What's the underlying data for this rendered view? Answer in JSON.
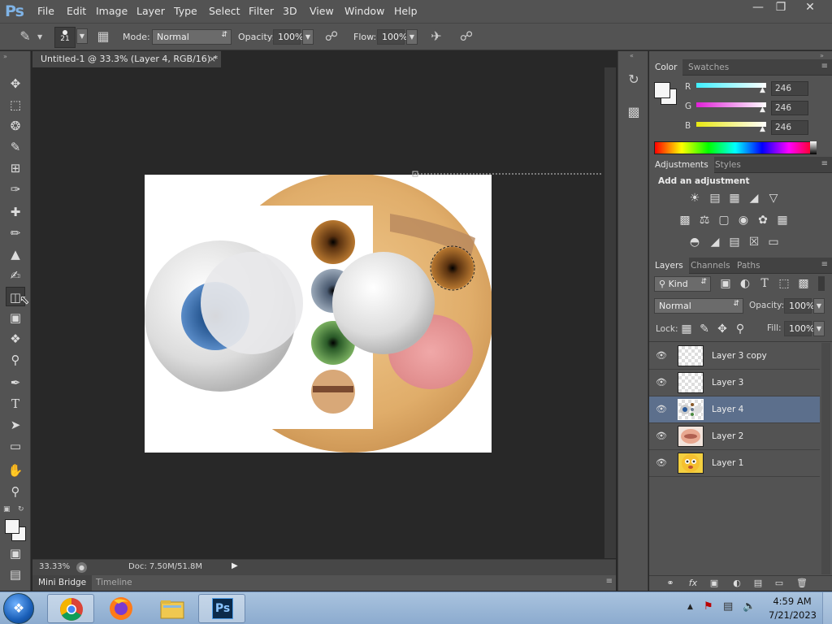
{
  "app": {
    "logo": "Ps"
  },
  "menu": [
    "File",
    "Edit",
    "Image",
    "Layer",
    "Type",
    "Select",
    "Filter",
    "3D",
    "View",
    "Window",
    "Help"
  ],
  "options": {
    "brush_size": "21",
    "mode_label": "Mode:",
    "mode_value": "Normal",
    "opacity_label": "Opacity:",
    "opacity_value": "100%",
    "flow_label": "Flow:",
    "flow_value": "100%"
  },
  "document": {
    "tab_title": "Untitled-1 @ 33.3% (Layer 4, RGB/16) *",
    "zoom": "33.33%",
    "doc_size": "Doc: 7.50M/51.8M"
  },
  "bottom_tabs": [
    "Mini Bridge",
    "Timeline"
  ],
  "color_panel": {
    "tabs": [
      "Color",
      "Swatches"
    ],
    "channels": [
      {
        "label": "R",
        "value": "246",
        "color": "#21d4e8"
      },
      {
        "label": "G",
        "value": "246",
        "color": "#e229d6"
      },
      {
        "label": "B",
        "value": "246",
        "color": "#e8e81c"
      }
    ]
  },
  "adjustments_panel": {
    "tabs": [
      "Adjustments",
      "Styles"
    ],
    "heading": "Add an adjustment"
  },
  "layers_panel": {
    "tabs": [
      "Layers",
      "Channels",
      "Paths"
    ],
    "kind_label": "Kind",
    "blend_mode": "Normal",
    "opacity_label": "Opacity:",
    "opacity_value": "100%",
    "lock_label": "Lock:",
    "fill_label": "Fill:",
    "fill_value": "100%",
    "layers": [
      {
        "name": "Layer 3 copy",
        "selected": false
      },
      {
        "name": "Layer 3",
        "selected": false
      },
      {
        "name": "Layer 4",
        "selected": true
      },
      {
        "name": "Layer 2",
        "selected": false
      },
      {
        "name": "Layer 1",
        "selected": false
      }
    ]
  },
  "taskbar": {
    "time": "4:59 AM",
    "date": "7/21/2023"
  }
}
